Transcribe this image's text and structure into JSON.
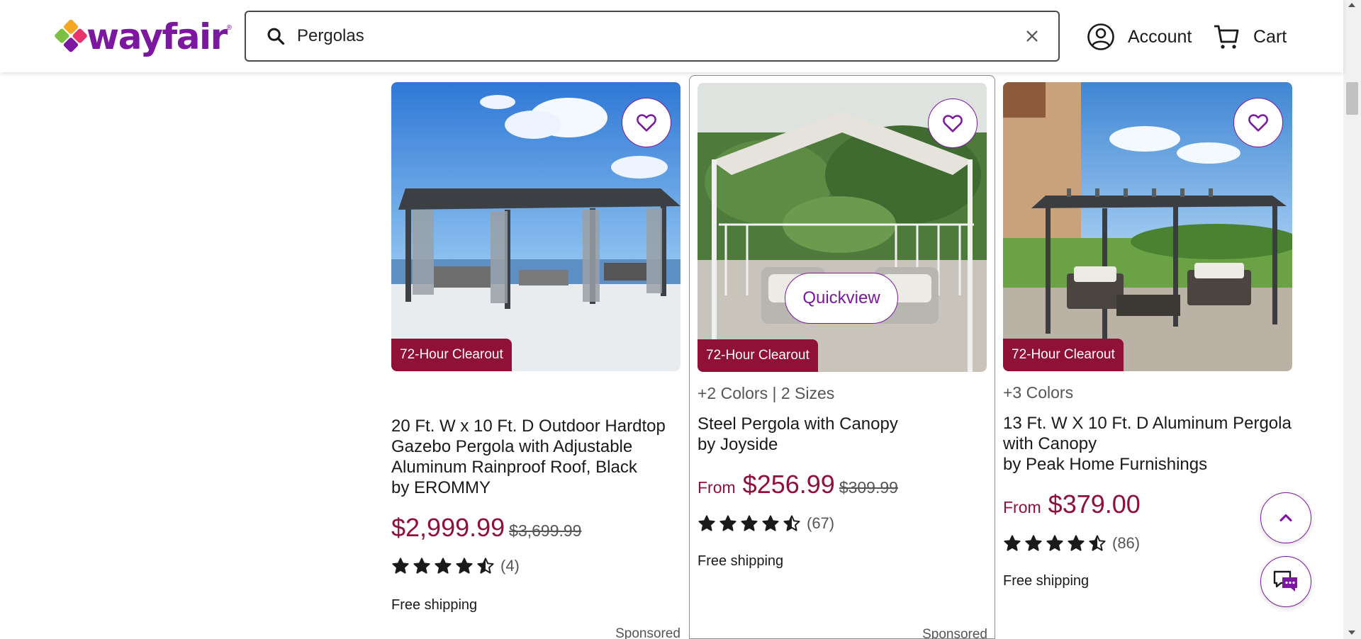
{
  "header": {
    "logo_text": "wayfair",
    "logo_reg": "®",
    "search_value": "Pergolas",
    "account_label": "Account",
    "cart_label": "Cart"
  },
  "products": [
    {
      "badge": "72-Hour Clearout",
      "options": "",
      "title": "20 Ft. W x 10 Ft. D Outdoor Hardtop Gazebo Pergola with Adjustable Aluminum Rainproof Roof, Black",
      "brand": "by EROMMY",
      "from_label": "",
      "price": "$2,999.99",
      "was_price": "$3,699.99",
      "rating": 4.5,
      "review_count": "(4)",
      "shipping": "Free shipping",
      "sponsored": "Sponsored"
    },
    {
      "badge": "72-Hour Clearout",
      "options": "+2 Colors | 2 Sizes",
      "title": "Steel Pergola with Canopy",
      "brand": "by Joyside",
      "from_label": "From",
      "price": "$256.99",
      "was_price": "$309.99",
      "rating": 4.5,
      "review_count": "(67)",
      "shipping": "Free shipping",
      "sponsored": "Sponsored",
      "quickview_label": "Quickview"
    },
    {
      "badge": "72-Hour Clearout",
      "options": "+3 Colors",
      "title": "13 Ft. W X 10 Ft. D Aluminum Pergola with Canopy",
      "brand": "by Peak Home Furnishings",
      "from_label": "From",
      "price": "$379.00",
      "was_price": "",
      "rating": 4.5,
      "review_count": "(86)",
      "shipping": "Free shipping",
      "sponsored": ""
    }
  ],
  "colors": {
    "brand_purple": "#7b189f",
    "price_red": "#8f1138",
    "badge_bg": "#8f1138"
  },
  "icons": {
    "search": "search-icon",
    "clear": "close-icon",
    "account": "user-icon",
    "cart": "cart-icon",
    "favorite": "heart-icon",
    "back_to_top": "chevron-up-icon",
    "chat": "chat-icon",
    "star": "star-icon"
  }
}
